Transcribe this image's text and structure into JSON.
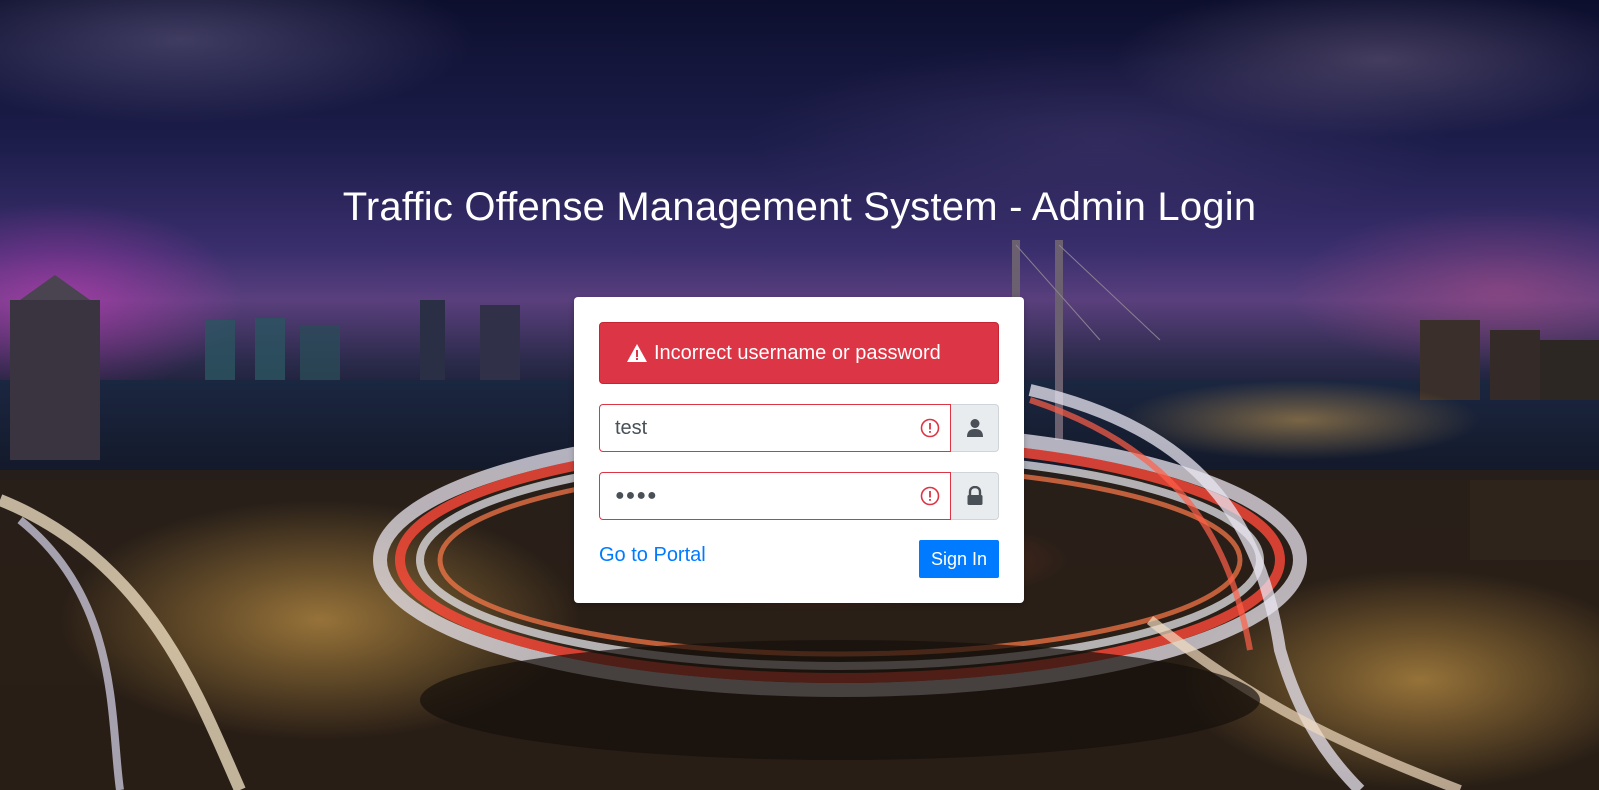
{
  "page": {
    "title": "Traffic Offense Management System - Admin Login"
  },
  "login": {
    "alert_message": "Incorrect username or password",
    "alert_icon": "warning-triangle-icon",
    "username_value": "test",
    "username_icon": "user-icon",
    "password_value": "●●●●",
    "password_icon": "lock-icon",
    "error_icon": "exclamation-circle-icon",
    "portal_link_label": "Go to Portal",
    "signin_label": "Sign In"
  },
  "colors": {
    "danger": "#dc3545",
    "primary": "#007bff",
    "addon_bg": "#e9ecef"
  }
}
